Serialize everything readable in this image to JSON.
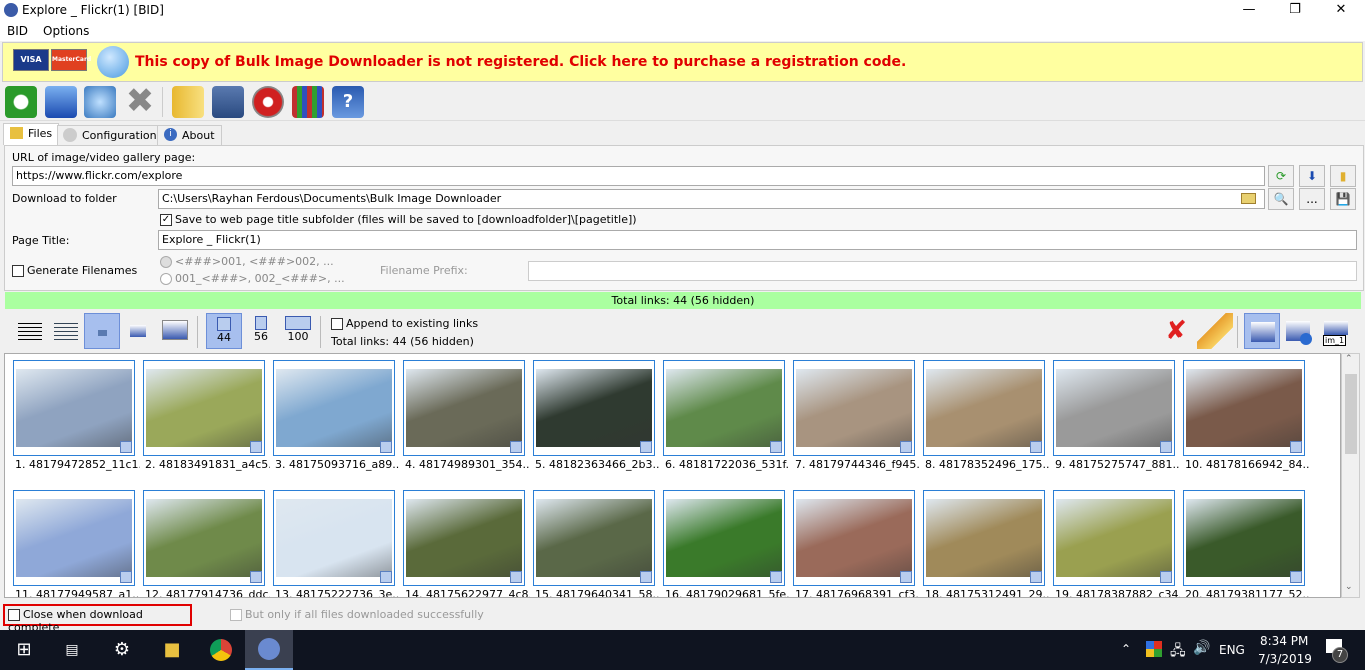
{
  "window": {
    "title": "Explore _ Flickr(1) [BID]"
  },
  "menu": [
    "BID",
    "Options"
  ],
  "banner": {
    "visa": "VISA",
    "mastercard": "MasterCard",
    "message": "This copy of Bulk Image Downloader is not registered. Click here to purchase a registration code."
  },
  "tabs": [
    {
      "label": "Files"
    },
    {
      "label": "Configuration"
    },
    {
      "label": "About"
    }
  ],
  "form": {
    "url_label": "URL of image/video gallery page:",
    "url_value": "https://www.flickr.com/explore",
    "folder_label": "Download to folder",
    "folder_value": "C:\\Users\\Rayhan Ferdous\\Documents\\Bulk Image Downloader",
    "subfolder_label": "Save to web page title subfolder (files will be saved to [downloadfolder]\\[pagetitle])",
    "subfolder_checked": true,
    "title_label": "Page Title:",
    "title_value": "Explore _ Flickr(1)",
    "gen_label": "Generate Filenames",
    "radio1": "<###>001, <###>002, ...",
    "radio2": "001_<###>, 002_<###>, ...",
    "prefix_label": "Filename Prefix:",
    "prefix_value": "",
    "more_label": "..."
  },
  "status": {
    "total": "Total links: 44 (56 hidden)"
  },
  "toolbar2": {
    "count1": "44",
    "count2": "56",
    "count3": "100",
    "append_label": "Append to existing links",
    "total": "Total links: 44 (56 hidden)",
    "name_btn": "im_1"
  },
  "thumbnails": [
    {
      "label": "1. 48179472852_11c1...",
      "color": "#8fa3c0"
    },
    {
      "label": "2. 48183491831_a4c5...",
      "color": "#9aa85a"
    },
    {
      "label": "3. 48175093716_a89...",
      "color": "#7fa8d0"
    },
    {
      "label": "4. 48174989301_354...",
      "color": "#6a6a58"
    },
    {
      "label": "5. 48182363466_2b3...",
      "color": "#2f3a30"
    },
    {
      "label": "6. 48181722036_531f...",
      "color": "#5f8a4a"
    },
    {
      "label": "7. 48179744346_f945...",
      "color": "#a89480"
    },
    {
      "label": "8. 48178352496_175...",
      "color": "#a89070"
    },
    {
      "label": "9. 48175275747_881...",
      "color": "#9a9a9a"
    },
    {
      "label": "10. 48178166942_84...",
      "color": "#7a5a4a"
    },
    {
      "label": "11. 48177949587_a1...",
      "color": "#8fa8d8"
    },
    {
      "label": "12. 48177914736_ddc...",
      "color": "#6f8a4a"
    },
    {
      "label": "13. 48175222736_3e...",
      "color": "#d8e4f0"
    },
    {
      "label": "14. 48175622977_4c8...",
      "color": "#5a6a3a"
    },
    {
      "label": "15. 48179640341_58...",
      "color": "#5a6848"
    },
    {
      "label": "16. 48179029681_5fe...",
      "color": "#3a7a2a"
    },
    {
      "label": "17. 48176968391_cf3...",
      "color": "#9a6a5a"
    },
    {
      "label": "18. 48175312491_29...",
      "color": "#a08a5a"
    },
    {
      "label": "19. 48178387882_c34...",
      "color": "#9aa050"
    },
    {
      "label": "20. 48179381177_52...",
      "color": "#3a5a2a"
    }
  ],
  "bottom": {
    "close_label": "Close when download complete",
    "only_label": "But only if all files downloaded successfully"
  },
  "taskbar": {
    "lang": "ENG",
    "time": "8:34 PM",
    "date": "7/3/2019",
    "notifications": "7"
  }
}
